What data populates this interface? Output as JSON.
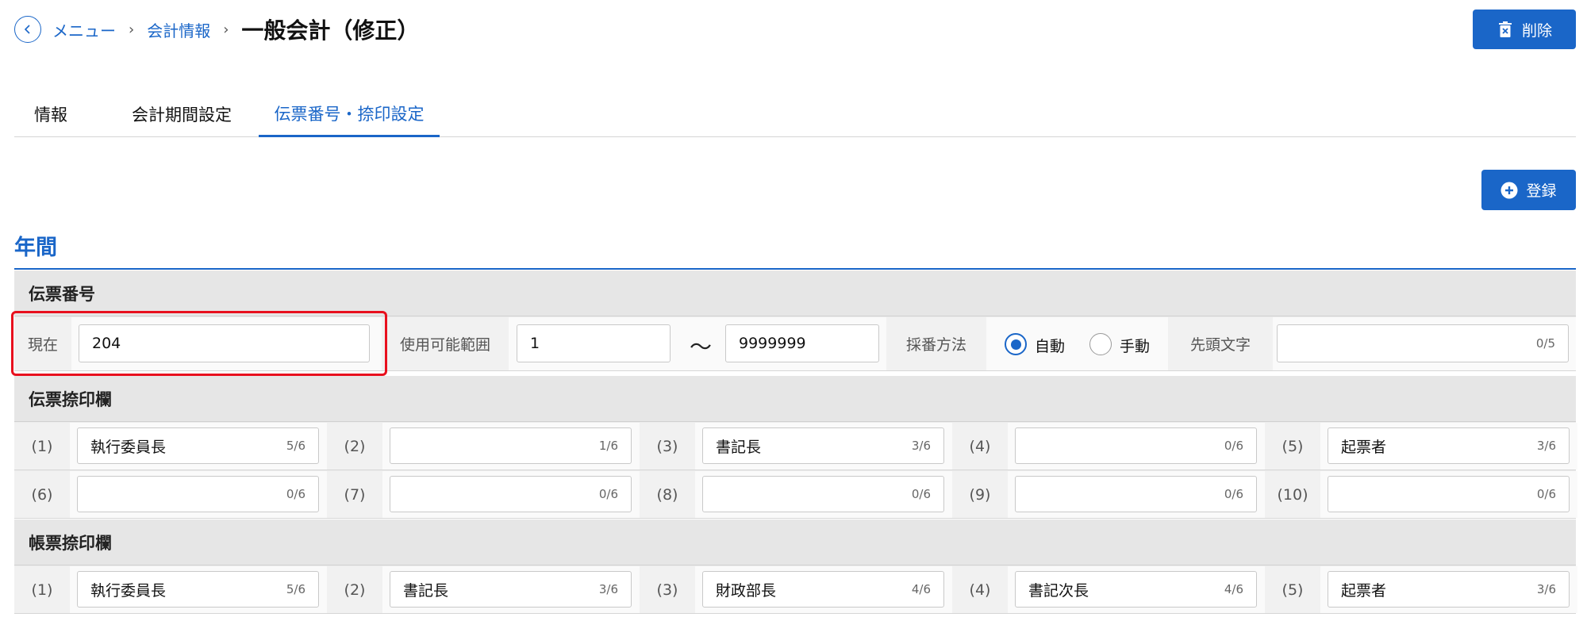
{
  "header": {
    "breadcrumb": [
      "メニュー",
      "会計情報"
    ],
    "title": "一般会計（修正）",
    "delete_label": "削除"
  },
  "tabs": [
    "情報",
    "会計期間設定",
    "伝票番号・捺印設定"
  ],
  "active_tab": "伝票番号・捺印設定",
  "register_label": "登録",
  "section_title": "年間",
  "voucher_number": {
    "heading": "伝票番号",
    "current_label": "現在",
    "current_value": "204",
    "range_label": "使用可能範囲",
    "range_from": "1",
    "range_tilde": "～",
    "range_to": "9999999",
    "method_label": "採番方法",
    "method_auto": "自動",
    "method_manual": "手動",
    "method_selected": "自動",
    "prefix_label": "先頭文字",
    "prefix_value": "",
    "prefix_counter": "0/5"
  },
  "voucher_seal": {
    "heading": "伝票捺印欄",
    "slots": [
      {
        "label": "(1)",
        "value": "執行委員長",
        "counter": "5/6"
      },
      {
        "label": "(2)",
        "value": "",
        "counter": "1/6"
      },
      {
        "label": "(3)",
        "value": "書記長",
        "counter": "3/6"
      },
      {
        "label": "(4)",
        "value": "",
        "counter": "0/6"
      },
      {
        "label": "(5)",
        "value": "起票者",
        "counter": "3/6"
      },
      {
        "label": "(6)",
        "value": "",
        "counter": "0/6"
      },
      {
        "label": "(7)",
        "value": "",
        "counter": "0/6"
      },
      {
        "label": "(8)",
        "value": "",
        "counter": "0/6"
      },
      {
        "label": "(9)",
        "value": "",
        "counter": "0/6"
      },
      {
        "label": "(10)",
        "value": "",
        "counter": "0/6"
      }
    ]
  },
  "report_seal": {
    "heading": "帳票捺印欄",
    "slots": [
      {
        "label": "(1)",
        "value": "執行委員長",
        "counter": "5/6"
      },
      {
        "label": "(2)",
        "value": "書記長",
        "counter": "3/6"
      },
      {
        "label": "(3)",
        "value": "財政部長",
        "counter": "4/6"
      },
      {
        "label": "(4)",
        "value": "書記次長",
        "counter": "4/6"
      },
      {
        "label": "(5)",
        "value": "起票者",
        "counter": "3/6"
      }
    ]
  },
  "colors": {
    "accent": "#1a66c8",
    "highlight": "#e8101e"
  }
}
